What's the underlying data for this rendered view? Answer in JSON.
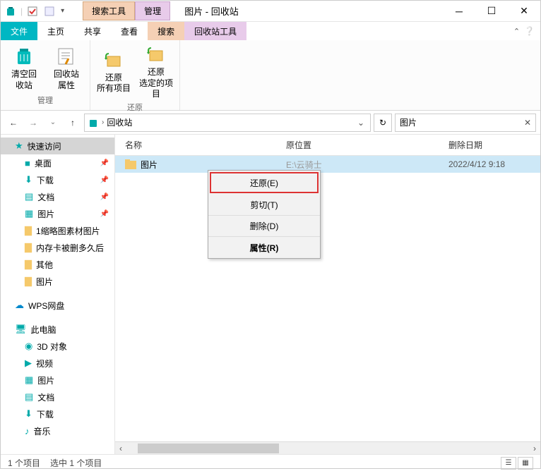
{
  "title": "图片 - 回收站",
  "tool_tabs": {
    "search": "搜索工具",
    "manage": "管理"
  },
  "menu": {
    "file": "文件",
    "home": "主页",
    "share": "共享",
    "view": "查看",
    "search": "搜索",
    "recycle": "回收站工具"
  },
  "ribbon": {
    "manage_group": "管理",
    "restore_group": "还原",
    "empty": "清空回\n收站",
    "props": "回收站\n属性",
    "restore_all": "还原\n所有项目",
    "restore_sel": "还原\n选定的项目"
  },
  "address": {
    "location": "回收站"
  },
  "search": {
    "value": "图片"
  },
  "sidebar": {
    "quick": "快速访问",
    "desktop": "桌面",
    "downloads": "下载",
    "docs": "文档",
    "pics": "图片",
    "thumb": "1缩略图素材图片",
    "memcard": "内存卡被删多久后",
    "other": "其他",
    "pics2": "图片",
    "wps": "WPS网盘",
    "thispc": "此电脑",
    "obj3d": "3D 对象",
    "videos": "视频",
    "pics3": "图片",
    "docs2": "文档",
    "downloads2": "下载",
    "music": "音乐"
  },
  "columns": {
    "name": "名称",
    "orig": "原位置",
    "date": "删除日期"
  },
  "rows": [
    {
      "name": "图片",
      "orig": "E:\\云骑士",
      "date": "2022/4/12 9:18"
    }
  ],
  "context_menu": {
    "restore": "还原(E)",
    "cut": "剪切(T)",
    "delete": "删除(D)",
    "props": "属性(R)"
  },
  "status": {
    "count": "1 个项目",
    "selected": "选中 1 个项目"
  }
}
